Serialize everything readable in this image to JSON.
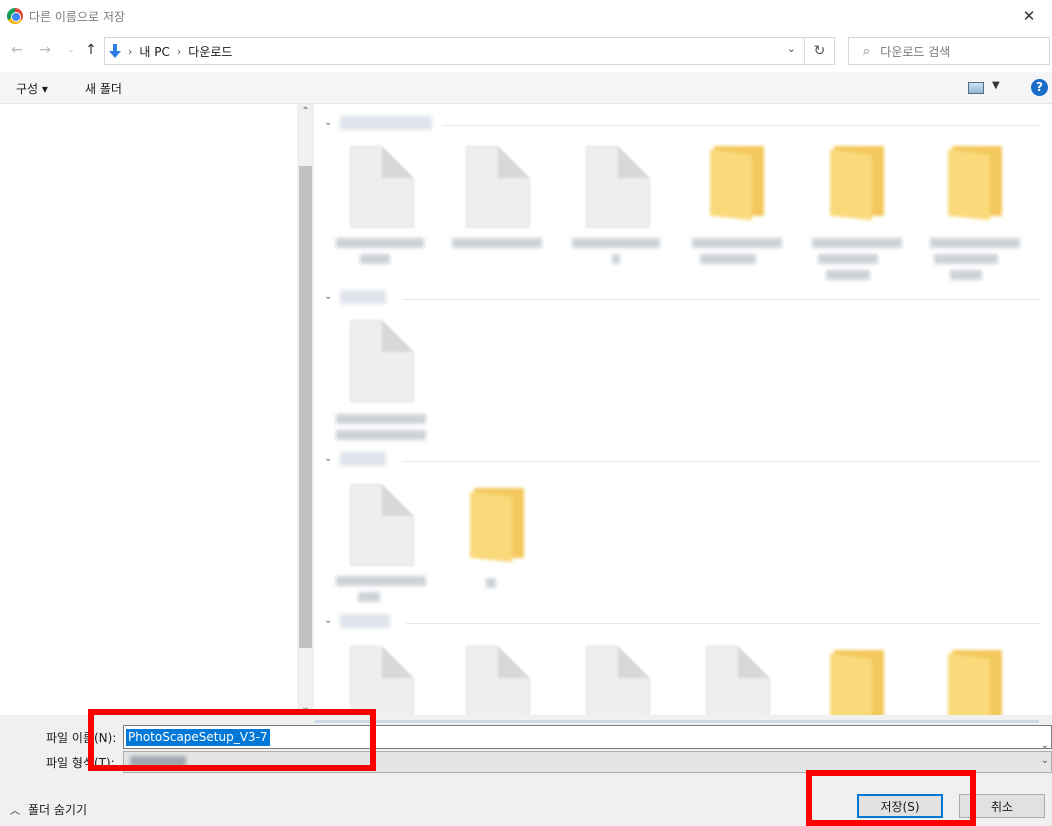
{
  "window": {
    "title": "다른 이름으로 저장",
    "close_icon": "close-icon"
  },
  "navigation": {
    "back_icon": "back-arrow-icon",
    "forward_icon": "forward-arrow-icon",
    "recent_icon": "chevron-down-icon",
    "up_icon": "up-arrow-icon",
    "breadcrumb": [
      "내 PC",
      "다운로드"
    ],
    "refresh_icon": "refresh-icon",
    "search_placeholder": "다운로드 검색"
  },
  "toolbar": {
    "organize_label": "구성 ▾",
    "new_folder_label": "새 폴더",
    "help_label": "?"
  },
  "file_view": {
    "groups": [
      "group-1",
      "group-2",
      "group-3",
      "group-4"
    ]
  },
  "save_form": {
    "filename_label": "파일 이름(N):",
    "filename_value": "PhotoScapeSetup_V3-7",
    "filetype_label": "파일 형식(T):",
    "hide_folders_label": "폴더 숨기기",
    "save_label": "저장(S)",
    "cancel_label": "취소"
  },
  "colors": {
    "accent": "#0078d7",
    "highlight_box": "#ff0000",
    "folder": "#f9d97a"
  }
}
